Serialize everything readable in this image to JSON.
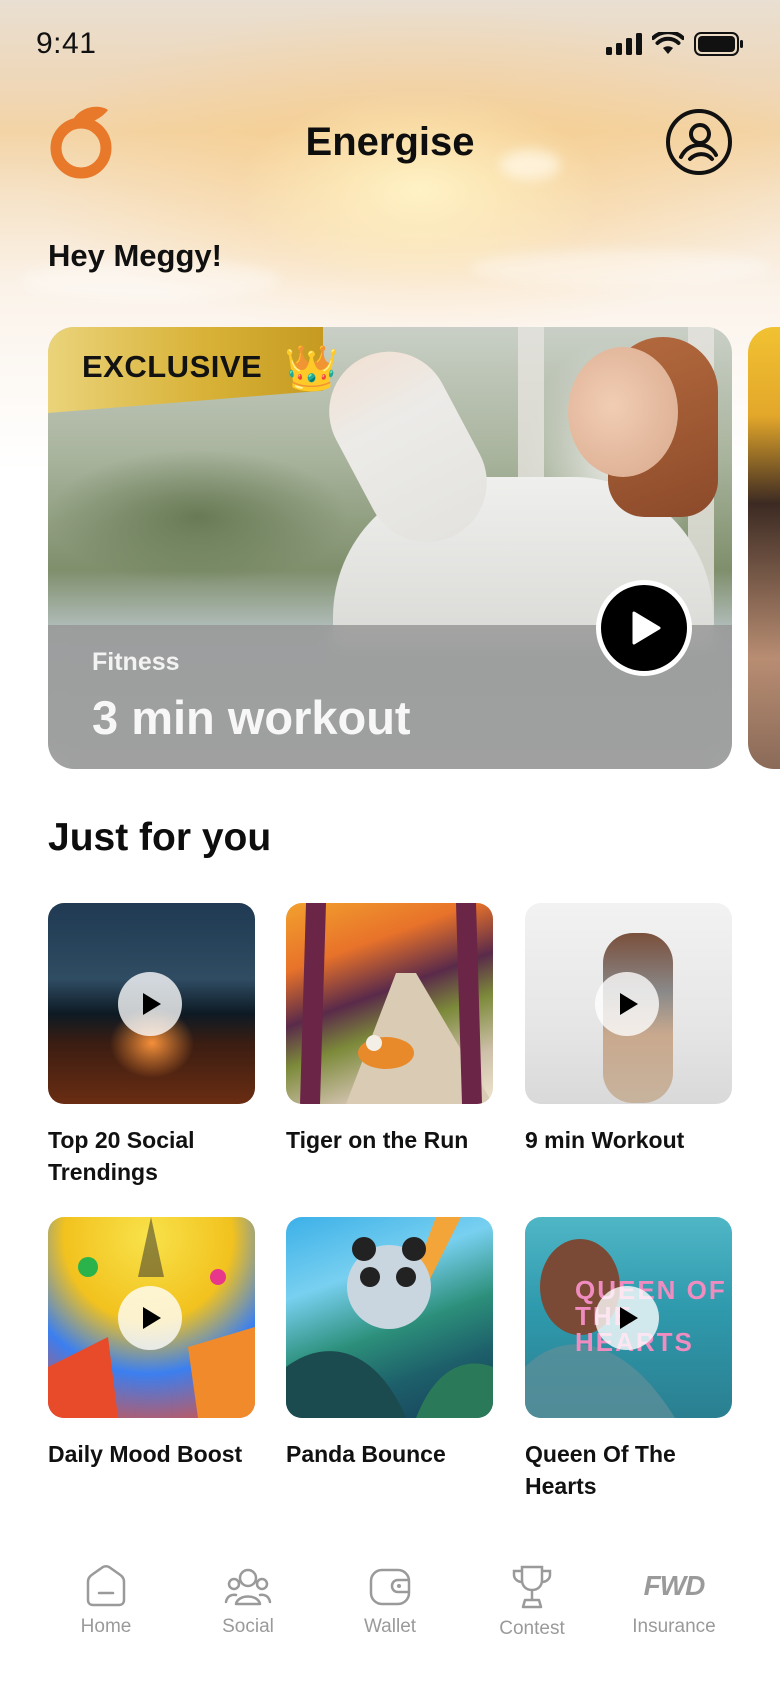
{
  "status_bar": {
    "time": "9:41"
  },
  "header": {
    "title": "Energise"
  },
  "greeting": "Hey Meggy!",
  "hero": {
    "badge": "EXCLUSIVE",
    "crown": "👑",
    "category": "Fitness",
    "title": "3 min workout"
  },
  "section": {
    "title": "Just for you"
  },
  "cards": [
    {
      "label": "Top 20 Social Trendings",
      "has_play": true
    },
    {
      "label": "Tiger on the Run",
      "has_play": false
    },
    {
      "label": "9 min Workout",
      "has_play": true
    },
    {
      "label": "Daily Mood Boost",
      "has_play": true
    },
    {
      "label": "Panda Bounce",
      "has_play": false
    },
    {
      "label": "Queen Of The Hearts",
      "has_play": true
    }
  ],
  "queen_art": {
    "text": "QUEEN OF THE HEARTS"
  },
  "tabs": [
    {
      "label": "Home",
      "icon": "home-icon"
    },
    {
      "label": "Social",
      "icon": "social-icon"
    },
    {
      "label": "Wallet",
      "icon": "wallet-icon"
    },
    {
      "label": "Contest",
      "icon": "trophy-icon"
    },
    {
      "label": "Insurance",
      "icon": "fwd-icon",
      "logo_text": "FWD"
    }
  ],
  "colors": {
    "accent": "#E8782A",
    "text": "#111111",
    "tab_inactive": "#9A9A9A",
    "badge_gold": "#D9B339"
  }
}
